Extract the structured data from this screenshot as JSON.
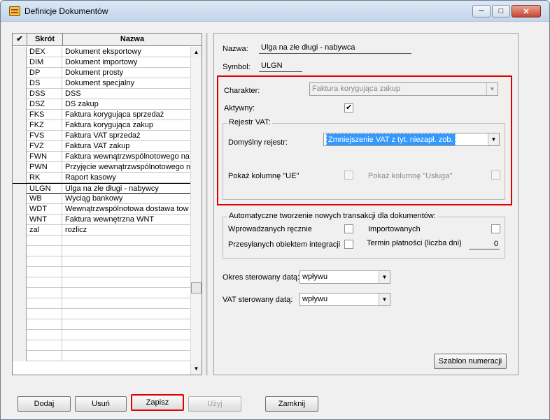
{
  "window": {
    "title": "Definicje Dokumentów"
  },
  "grid": {
    "headers": {
      "check": "✔",
      "code": "Skrót",
      "name": "Nazwa"
    },
    "rows": [
      {
        "code": "DEX",
        "name": "Dokument eksportowy"
      },
      {
        "code": "DIM",
        "name": "Dokument importowy"
      },
      {
        "code": "DP",
        "name": "Dokument prosty"
      },
      {
        "code": "DS",
        "name": "Dokument specjalny"
      },
      {
        "code": "DSS",
        "name": "DSS"
      },
      {
        "code": "DSZ",
        "name": "DS zakup"
      },
      {
        "code": "FKS",
        "name": "Faktura korygująca sprzedaż"
      },
      {
        "code": "FKZ",
        "name": "Faktura korygująca zakup"
      },
      {
        "code": "FVS",
        "name": "Faktura VAT sprzedaż"
      },
      {
        "code": "FVZ",
        "name": "Faktura VAT zakup"
      },
      {
        "code": "FWN",
        "name": "Faktura wewnątrzwspólnotowego na"
      },
      {
        "code": "PWN",
        "name": "Przyjęcie wewnątrzwspólnotowego n"
      },
      {
        "code": "RK",
        "name": "Raport kasowy"
      },
      {
        "code": "ULGN",
        "name": "Ulga na złe długi - nabywcy"
      },
      {
        "code": "WB",
        "name": "Wyciąg bankowy"
      },
      {
        "code": "WDT",
        "name": "Wewnątrzwspólnotowa dostawa tow"
      },
      {
        "code": "WNT",
        "name": "Faktura wewnętrzna WNT"
      },
      {
        "code": "zal",
        "name": "rozlicz"
      },
      {
        "code": "",
        "name": ""
      },
      {
        "code": "",
        "name": ""
      },
      {
        "code": "",
        "name": ""
      },
      {
        "code": "",
        "name": ""
      },
      {
        "code": "",
        "name": ""
      },
      {
        "code": "",
        "name": ""
      },
      {
        "code": "",
        "name": ""
      },
      {
        "code": "",
        "name": ""
      },
      {
        "code": "",
        "name": ""
      },
      {
        "code": "",
        "name": ""
      },
      {
        "code": "",
        "name": ""
      },
      {
        "code": "",
        "name": ""
      }
    ],
    "selected_code": "ULGN"
  },
  "form": {
    "nazwa_label": "Nazwa:",
    "nazwa_value": "Ulga na złe długi - nabywca",
    "symbol_label": "Symbol:",
    "symbol_value": "ULGN",
    "charakter_label": "Charakter:",
    "charakter_value": "Faktura korygująca zakup",
    "aktywny_label": "Aktywny:",
    "aktywny_checked": true,
    "rejestr_group": "Rejestr VAT:",
    "domyslny_label": "Domyślny rejestr:",
    "domyslny_value": "Zmniejszenie VAT z tyt. niezapł. zob.",
    "ue_label": "Pokaż kolumnę \"UE\"",
    "usluga_label": "Pokaż kolumnę \"Usługa\"",
    "auto_group": "Automatyczne tworzenie nowych transakcji dla dokumentów:",
    "wprowadzanych_label": "Wprowadzanych ręcznie",
    "importowanych_label": "Importowanych",
    "przesylanych_label": "Przesyłanych obiektem integracji",
    "termin_label": "Termin płatności (liczba dni)",
    "termin_value": "0",
    "okres_label": "Okres sterowany datą:",
    "okres_value": "wpływu",
    "vat_label": "VAT sterowany datą:",
    "vat_value": "wpływu",
    "szablon_button": "Szablon numeracji"
  },
  "buttons": {
    "dodaj": "Dodaj",
    "usun": "Usuń",
    "zapisz": "Zapisz",
    "uzyj": "Użyj",
    "zamknij": "Zamknij"
  },
  "colors": {
    "highlight_red": "#e00000",
    "selection_blue": "#3399ff"
  }
}
